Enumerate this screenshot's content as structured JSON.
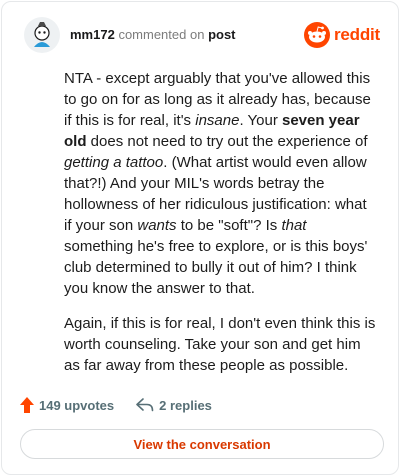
{
  "header": {
    "username": "mm172",
    "verb": "commented on",
    "post_link": "post",
    "brand": "reddit"
  },
  "comment": {
    "p1": {
      "t1": "NTA - except arguably that you've allowed this to go on for as long as it already has, because if this is for real, it's ",
      "insane": "insane",
      "t2": ". Your ",
      "bold": "seven year old",
      "t3": " does not need to try out the experience of ",
      "tattoo": "getting a tattoo",
      "t4": ". (What artist would even allow that?!) And your MIL's words betray the hollowness of her ridiculous justification: what if your son ",
      "wants": "wants",
      "t5": " to be \"soft\"? Is ",
      "that": "that",
      "t6": " something he's free to explore, or is this boys' club determined to bully it out of him? I think you know the answer to that."
    },
    "p2": "Again, if this is for real, I don't even think this is worth counseling. Take your son and get him as far away from these people as possible."
  },
  "actions": {
    "upvotes": "149 upvotes",
    "replies": "2 replies"
  },
  "cta": "View the conversation",
  "colors": {
    "brand": "#ff4500",
    "cta": "#d93900",
    "upvote": "#ff4500"
  },
  "icons": [
    "avatar",
    "reddit-logo-icon",
    "upvote-arrow-icon",
    "reply-icon"
  ]
}
